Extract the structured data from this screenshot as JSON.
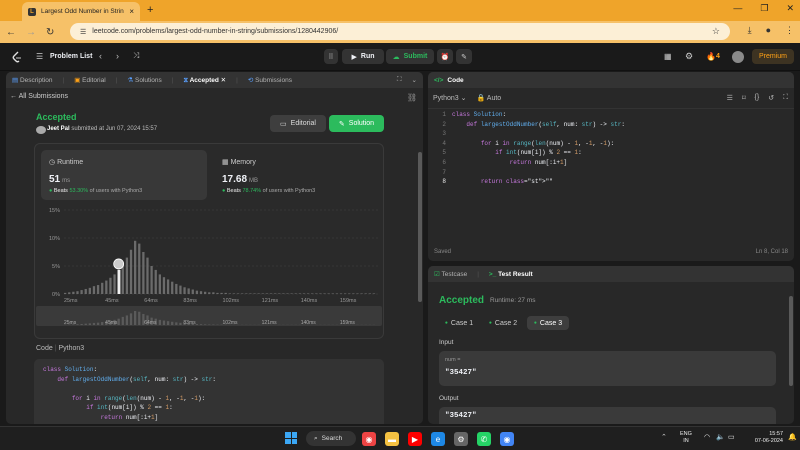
{
  "browser": {
    "tab_title": "Largest Odd Number in Strin",
    "url": "leetcode.com/problems/largest-odd-number-in-string/submissions/1280442906/"
  },
  "nav": {
    "problem_list": "Problem List",
    "run": "Run",
    "submit": "Submit",
    "streak": "4",
    "premium": "Premium"
  },
  "left": {
    "tabs": [
      "Description",
      "Editorial",
      "Solutions",
      "Accepted",
      "Submissions"
    ],
    "all_submissions": "All Submissions",
    "status": "Accepted",
    "user": "Jeet Pal",
    "submitted": "submitted at Jun 07, 2024 15:57",
    "editorial_btn": "Editorial",
    "solution_btn": "Solution",
    "runtime_label": "Runtime",
    "runtime_value": "51",
    "runtime_unit": "ms",
    "runtime_beats_prefix": "Beats",
    "runtime_beats_pct": "53.30%",
    "runtime_beats_suffix": "of users with Python3",
    "memory_label": "Memory",
    "memory_value": "17.68",
    "memory_unit": "MB",
    "memory_beats_prefix": "Beats",
    "memory_beats_pct": "78.74%",
    "memory_beats_suffix": "of users with Python3",
    "code_label": "Code",
    "code_lang": "Python3"
  },
  "chart_data": {
    "type": "bar",
    "title": "",
    "xlabel": "",
    "ylabel": "",
    "y_ticks": [
      "15%",
      "10%",
      "5%",
      "0%"
    ],
    "ylim": [
      0,
      15
    ],
    "x_ticks": [
      "25ms",
      "45ms",
      "64ms",
      "83ms",
      "102ms",
      "121ms",
      "140ms",
      "159ms"
    ],
    "x_range_ms": [
      25,
      178
    ],
    "bin_ms": 2,
    "highlight_ms": 51,
    "values": [
      0.2,
      0.3,
      0.4,
      0.5,
      0.7,
      0.9,
      1.1,
      1.4,
      1.6,
      2.0,
      2.4,
      2.9,
      3.5,
      4.3,
      5.5,
      6.5,
      7.9,
      9.5,
      9.0,
      7.5,
      6.5,
      5.0,
      4.3,
      3.5,
      3.0,
      2.6,
      2.2,
      1.8,
      1.5,
      1.2,
      1.0,
      0.8,
      0.6,
      0.5,
      0.4,
      0.3,
      0.3,
      0.2,
      0.2,
      0.2,
      0.1,
      0.1,
      0.1,
      0.1,
      0.1,
      0.1,
      0.1,
      0.1,
      0.1,
      0.1,
      0.1,
      0.1,
      0.1,
      0.1,
      0.1,
      0.1,
      0.1,
      0.1,
      0.1,
      0.1,
      0.1,
      0.1,
      0.1,
      0.1,
      0.1,
      0.1,
      0.1,
      0.1,
      0.1,
      0.1,
      0.1,
      0.1,
      0.1,
      0.1,
      0.1,
      0.1
    ],
    "grid": true
  },
  "left_code": [
    "class Solution:",
    "    def largestOddNumber(self, num: str) -> str:",
    "",
    "        for i in range(len(num) - 1, -1, -1):",
    "            if int(num[i]) % 2 == 1:",
    "                return num[:i+1]"
  ],
  "editor": {
    "title": "Code",
    "lang": "Python3",
    "auto": "Auto",
    "lines": [
      "class Solution:",
      "    def largestOddNumber(self, num: str) -> str:",
      "",
      "        for i in range(len(num) - 1, -1, -1):",
      "            if int(num[i]) % 2 == 1:",
      "                return num[:i+1]",
      "",
      "        return \"\""
    ],
    "line_numbers": [
      "1",
      "2",
      "3",
      "4",
      "5",
      "6",
      "7",
      "8"
    ],
    "saved": "Saved",
    "position": "Ln 8, Col 18"
  },
  "result": {
    "tab_testcase": "Testcase",
    "tab_result": "Test Result",
    "status": "Accepted",
    "runtime": "Runtime: 27 ms",
    "cases": [
      "Case 1",
      "Case 2",
      "Case 3"
    ],
    "input_label": "Input",
    "input_var": "num =",
    "input_value": "\"35427\"",
    "output_label": "Output",
    "output_value": "\"35427\""
  },
  "taskbar": {
    "search": "Search",
    "lang1": "ENG",
    "lang2": "IN",
    "time": "15:57",
    "date": "07-06-2024"
  }
}
